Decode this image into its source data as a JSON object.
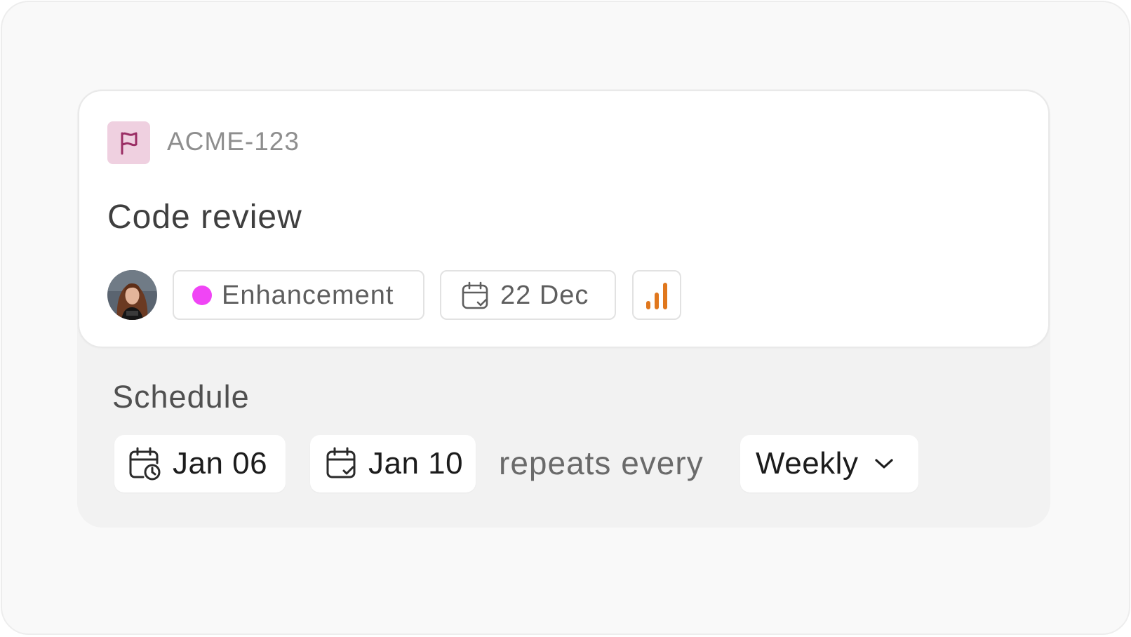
{
  "issue": {
    "id": "ACME-123",
    "title": "Code review",
    "flag_icon": "flag-icon",
    "flag_color": "#9a2d64",
    "flag_bg": "#efd0e0"
  },
  "meta": {
    "assignee_avatar": "avatar",
    "label": {
      "text": "Enhancement",
      "dot_color": "#f045f5"
    },
    "due_date": {
      "text": "22 Dec",
      "icon": "calendar-check-icon"
    },
    "priority": {
      "icon": "signal-bars-icon",
      "level": 3,
      "of": 3,
      "color": "#e0771d"
    }
  },
  "schedule": {
    "heading": "Schedule",
    "start": {
      "text": "Jan 06",
      "icon": "calendar-clock-icon"
    },
    "end": {
      "text": "Jan 10",
      "icon": "calendar-check-icon"
    },
    "repeats_text": "repeats every",
    "frequency": {
      "selected": "Weekly",
      "icon": "chevron-down-icon"
    }
  }
}
